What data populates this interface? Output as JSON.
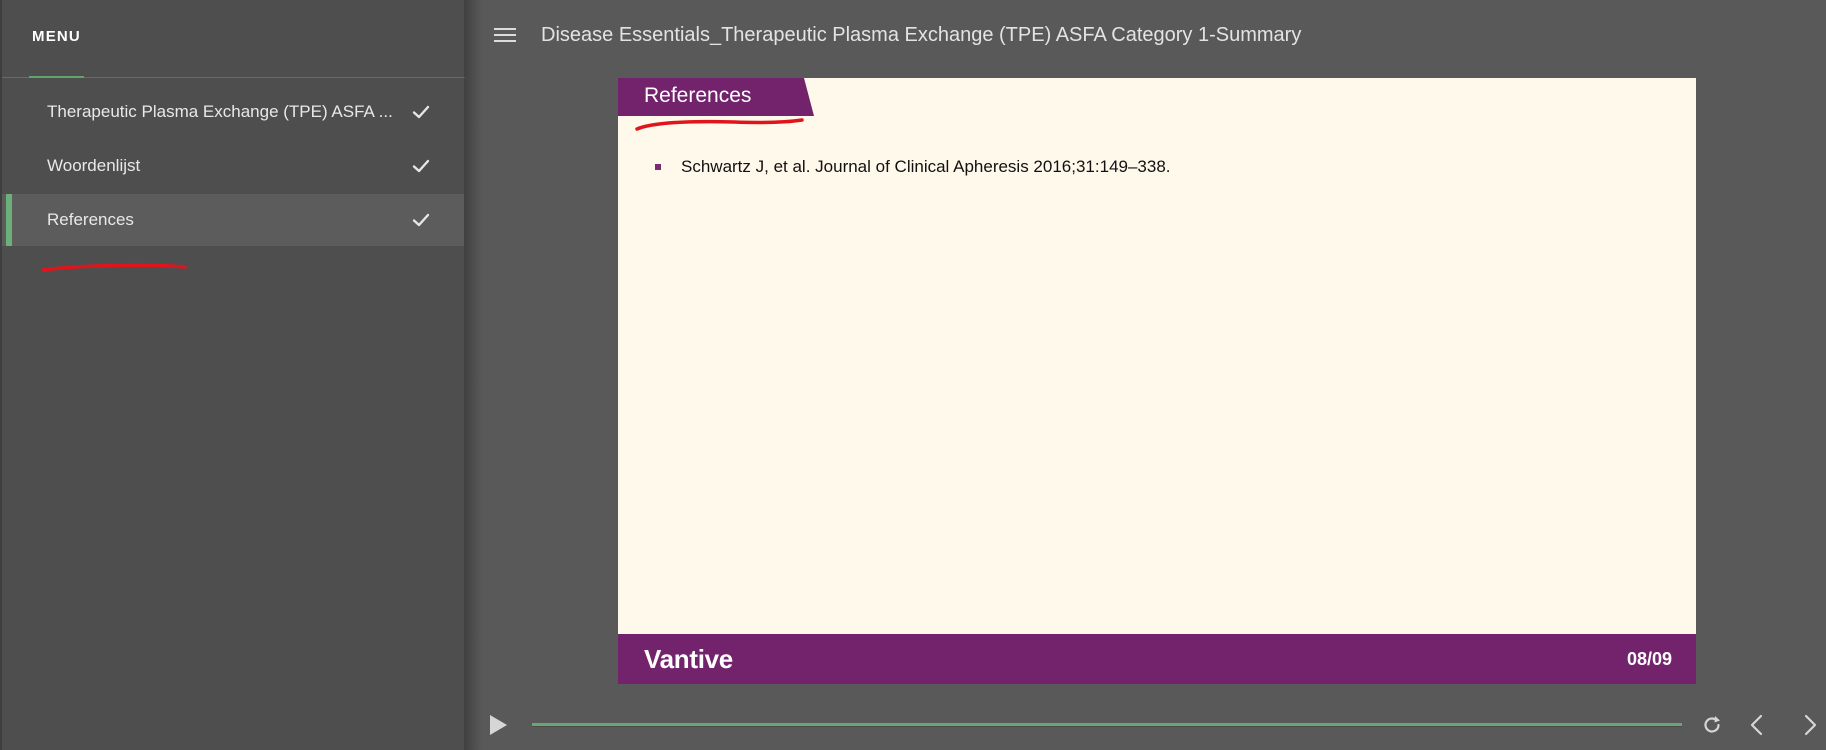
{
  "sidebar": {
    "title": "MENU",
    "items": [
      {
        "label": "Therapeutic Plasma Exchange (TPE) ASFA ...",
        "completed": true,
        "active": false
      },
      {
        "label": "Woordenlijst",
        "completed": true,
        "active": false
      },
      {
        "label": "References",
        "completed": true,
        "active": true
      }
    ]
  },
  "header": {
    "course_title": "Disease Essentials_Therapeutic Plasma Exchange (TPE) ASFA Category 1-Summary"
  },
  "slide": {
    "title": "References",
    "references": [
      "Schwartz J, et al. Journal of Clinical Apheresis 2016;31:149–338."
    ],
    "brand": "Vantive",
    "page_indicator": "08/09"
  },
  "player": {
    "progress": 1.0
  },
  "colors": {
    "accent_green": "#6bb07a",
    "slide_purple": "#73236c",
    "slide_background": "#fff9ec",
    "annotation_red": "#e0141c"
  },
  "icons": {
    "menu": "hamburger-icon",
    "completed": "checkmark-icon",
    "play": "play-icon",
    "replay": "replay-icon",
    "previous": "chevron-left-icon",
    "next": "chevron-right-icon"
  }
}
